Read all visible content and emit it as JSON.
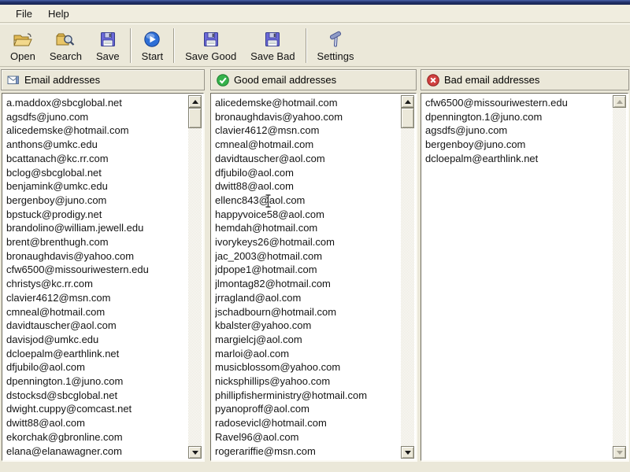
{
  "colors": {
    "titlebar_navy": "#22326b",
    "window_background": "#ebe8d9",
    "good_green": "#35b24b",
    "bad_red": "#d04040",
    "list_background": "#ffffff"
  },
  "menu": {
    "items": [
      {
        "label": "File"
      },
      {
        "label": "Help"
      }
    ]
  },
  "toolbar": {
    "buttons": [
      {
        "label": "Open",
        "icon": "open-folder-icon"
      },
      {
        "label": "Search",
        "icon": "search-folder-icon"
      },
      {
        "label": "Save",
        "icon": "floppy-disk-icon"
      },
      {
        "label": "Start",
        "icon": "start-play-icon"
      },
      {
        "label": "Save Good",
        "icon": "floppy-disk-icon"
      },
      {
        "label": "Save Bad",
        "icon": "floppy-disk-icon"
      },
      {
        "label": "Settings",
        "icon": "tools-hammer-icon"
      }
    ]
  },
  "panels": [
    {
      "title": "Email addresses",
      "icon": "email-envelope-icon",
      "emails": [
        "a.maddox@sbcglobal.net",
        "agsdfs@juno.com",
        "alicedemske@hotmail.com",
        "anthons@umkc.edu",
        "bcattanach@kc.rr.com",
        "bclog@sbcglobal.net",
        "benjamink@umkc.edu",
        "bergenboy@juno.com",
        "bpstuck@prodigy.net",
        "brandolino@william.jewell.edu",
        "brent@brenthugh.com",
        "bronaughdavis@yahoo.com",
        "cfw6500@missouriwestern.edu",
        "christys@kc.rr.com",
        "clavier4612@msn.com",
        "cmneal@hotmail.com",
        "davidtauscher@aol.com",
        "davisjod@umkc.edu",
        "dcloepalm@earthlink.net",
        "dfjubilo@aol.com",
        "dpennington.1@juno.com",
        "dstocksd@sbcglobal.net",
        "dwight.cuppy@comcast.net",
        "dwitt88@aol.com",
        "ekorchak@gbronline.com",
        "elana@elanawagner.com"
      ]
    },
    {
      "title": "Good email addresses",
      "icon": "good-check-icon",
      "emails": [
        "alicedemske@hotmail.com",
        "bronaughdavis@yahoo.com",
        "clavier4612@msn.com",
        "cmneal@hotmail.com",
        "davidtauscher@aol.com",
        "dfjubilo@aol.com",
        "dwitt88@aol.com",
        "ellenc843@aol.com",
        "happyvoice58@aol.com",
        "hemdah@hotmail.com",
        "ivorykeys26@hotmail.com",
        "jac_2003@hotmail.com",
        "jdpope1@hotmail.com",
        "jlmontag82@hotmail.com",
        "jrragland@aol.com",
        "jschadbourn@hotmail.com",
        "kbalster@yahoo.com",
        "margielcj@aol.com",
        "marloi@aol.com",
        "musicblossom@yahoo.com",
        "nicksphillips@yahoo.com",
        "phillipfisherministry@hotmail.com",
        "pyanoproff@aol.com",
        "radosevicl@hotmail.com",
        "Ravel96@aol.com",
        "rogerariffie@msn.com"
      ]
    },
    {
      "title": "Bad email addresses",
      "icon": "bad-x-icon",
      "emails": [
        "cfw6500@missouriwestern.edu",
        "dpennington.1@juno.com",
        "agsdfs@juno.com",
        "bergenboy@juno.com",
        "dcloepalm@earthlink.net"
      ]
    }
  ]
}
